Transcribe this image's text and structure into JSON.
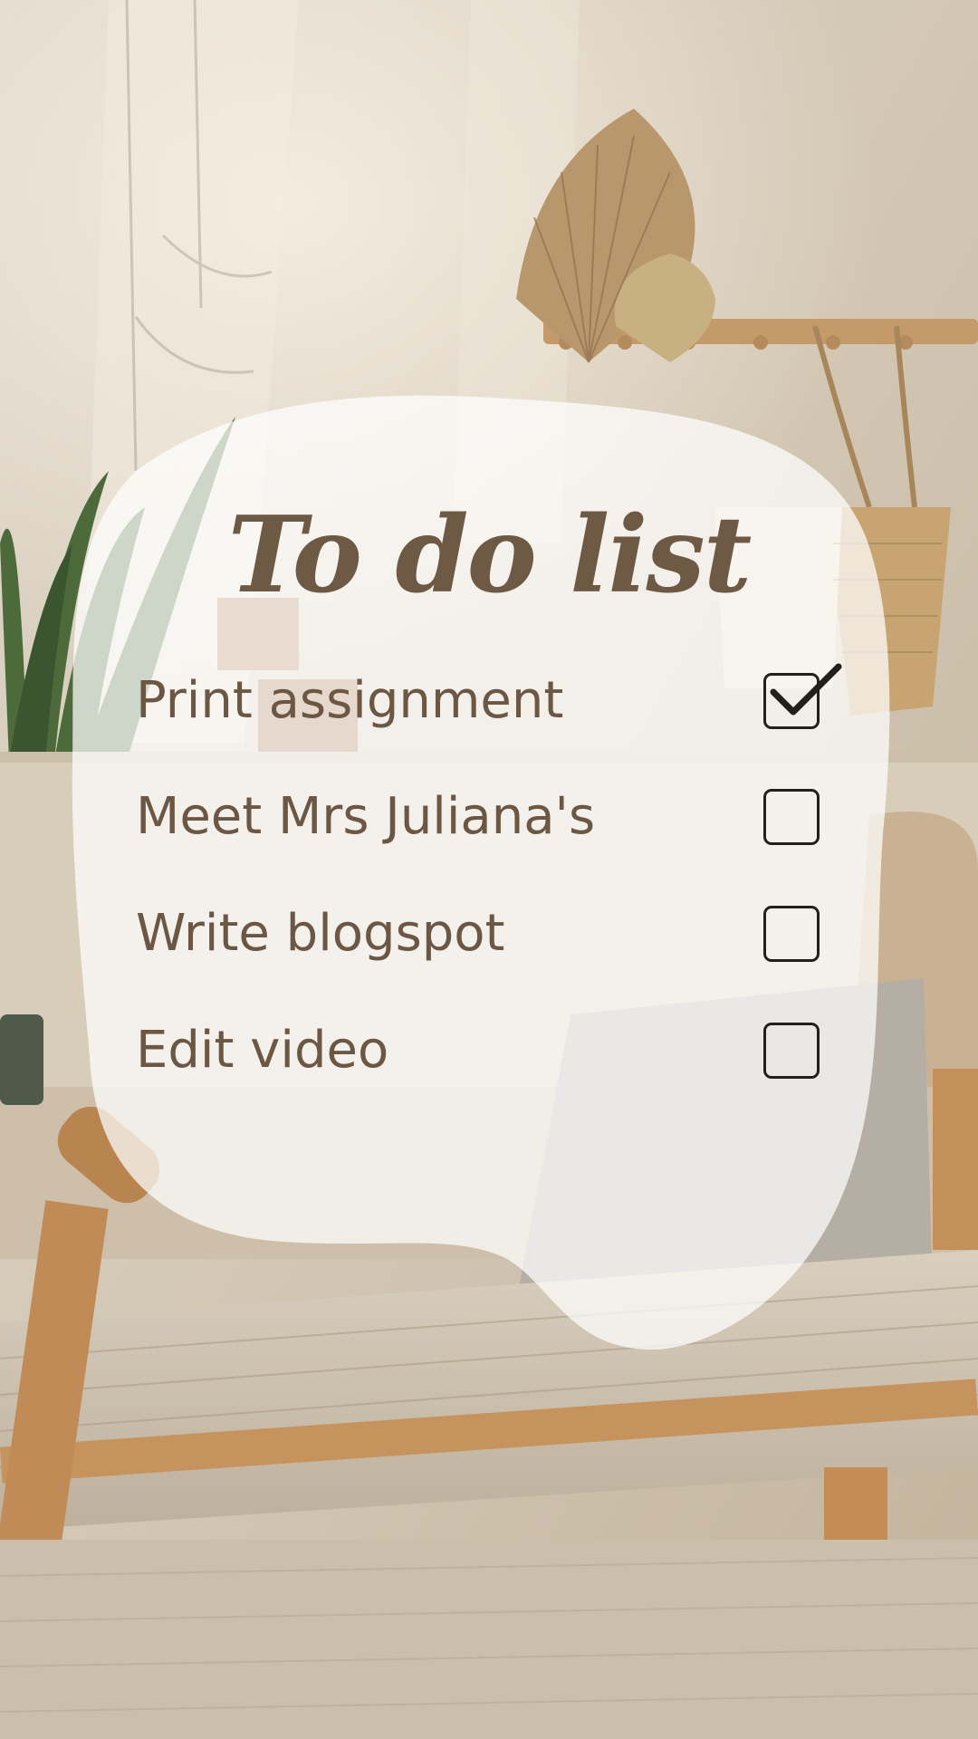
{
  "title": "To do list",
  "tasks": [
    {
      "label": "Print assignment",
      "checked": true
    },
    {
      "label": "Meet Mrs Juliana's",
      "checked": false
    },
    {
      "label": "Write blogspot",
      "checked": false
    },
    {
      "label": "Edit video",
      "checked": false
    }
  ],
  "colors": {
    "text": "#6b5743",
    "title": "#6e5a44",
    "checkbox_border": "#231f1c",
    "card": "#ffffff"
  }
}
